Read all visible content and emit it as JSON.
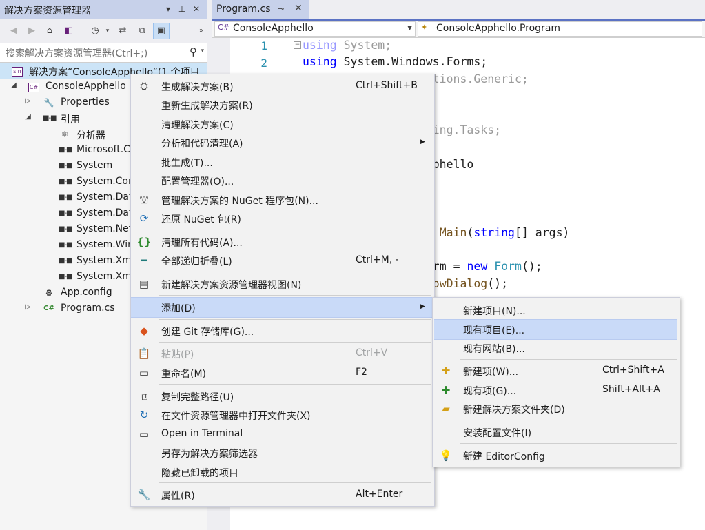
{
  "explorer": {
    "title": "解决方案资源管理器",
    "title_buttons": [
      "▾",
      "⊥",
      "✕"
    ],
    "search_placeholder": "搜索解决方案资源管理器(Ctrl+;)",
    "tree": [
      {
        "label": "解决方案“ConsoleApphello”(1 个项目",
        "icon": "solution-icon"
      },
      {
        "label": "ConsoleApphello",
        "icon": "csharp-project-icon"
      },
      {
        "label": "Properties",
        "icon": "wrench-icon"
      },
      {
        "label": "引用",
        "icon": "references-icon"
      },
      {
        "label": "分析器",
        "icon": "analyzer-icon"
      },
      {
        "label": "Microsoft.C",
        "icon": "reference-icon"
      },
      {
        "label": "System",
        "icon": "reference-icon"
      },
      {
        "label": "System.Cor",
        "icon": "reference-icon"
      },
      {
        "label": "System.Dat",
        "icon": "reference-icon"
      },
      {
        "label": "System.Dat",
        "icon": "reference-icon"
      },
      {
        "label": "System.Net",
        "icon": "reference-icon"
      },
      {
        "label": "System.Wir",
        "icon": "reference-icon"
      },
      {
        "label": "System.Xm",
        "icon": "reference-icon"
      },
      {
        "label": "System.Xm",
        "icon": "reference-icon"
      },
      {
        "label": "App.config",
        "icon": "config-file-icon"
      },
      {
        "label": "Program.cs",
        "icon": "csharp-file-icon"
      }
    ]
  },
  "editor": {
    "tab_label": "Program.cs",
    "nav_left": "ConsoleApphello",
    "nav_right": "ConsoleApphello.Program",
    "line_numbers": [
      "1",
      "2"
    ]
  },
  "context_menu": {
    "items": [
      {
        "label": "生成解决方案(B)",
        "shortcut": "Ctrl+Shift+B"
      },
      {
        "label": "重新生成解决方案(R)",
        "shortcut": ""
      },
      {
        "label": "清理解决方案(C)",
        "shortcut": ""
      },
      {
        "label": "分析和代码清理(A)",
        "shortcut": ""
      },
      {
        "label": "批生成(T)...",
        "shortcut": ""
      },
      {
        "label": "配置管理器(O)...",
        "shortcut": ""
      },
      {
        "label": "管理解决方案的 NuGet 程序包(N)...",
        "shortcut": ""
      },
      {
        "label": "还原 NuGet 包(R)",
        "shortcut": ""
      },
      {
        "label": "清理所有代码(A)...",
        "shortcut": ""
      },
      {
        "label": "全部递归折叠(L)",
        "shortcut": "Ctrl+M, -"
      },
      {
        "label": "新建解决方案资源管理器视图(N)",
        "shortcut": ""
      },
      {
        "label": "添加(D)",
        "shortcut": ""
      },
      {
        "label": "创建 Git 存储库(G)...",
        "shortcut": ""
      },
      {
        "label": "粘贴(P)",
        "shortcut": "Ctrl+V"
      },
      {
        "label": "重命名(M)",
        "shortcut": "F2"
      },
      {
        "label": "复制完整路径(U)",
        "shortcut": ""
      },
      {
        "label": "在文件资源管理器中打开文件夹(X)",
        "shortcut": ""
      },
      {
        "label": "Open in Terminal",
        "shortcut": ""
      },
      {
        "label": "另存为解决方案筛选器",
        "shortcut": ""
      },
      {
        "label": "隐藏已卸载的项目",
        "shortcut": ""
      },
      {
        "label": "属性(R)",
        "shortcut": "Alt+Enter"
      }
    ]
  },
  "submenu": {
    "items": [
      {
        "label": "新建项目(N)...",
        "shortcut": ""
      },
      {
        "label": "现有项目(E)...",
        "shortcut": ""
      },
      {
        "label": "现有网站(B)...",
        "shortcut": ""
      },
      {
        "label": "新建项(W)...",
        "shortcut": "Ctrl+Shift+A"
      },
      {
        "label": "现有项(G)...",
        "shortcut": "Shift+Alt+A"
      },
      {
        "label": "新建解决方案文件夹(D)",
        "shortcut": ""
      },
      {
        "label": "安装配置文件(I)",
        "shortcut": ""
      },
      {
        "label": "新建 EditorConfig",
        "shortcut": ""
      }
    ]
  },
  "colors": {
    "accent": "#5b72c4",
    "highlight": "#c9daf8",
    "keyword": "#0000ff",
    "type": "#2b91af"
  }
}
